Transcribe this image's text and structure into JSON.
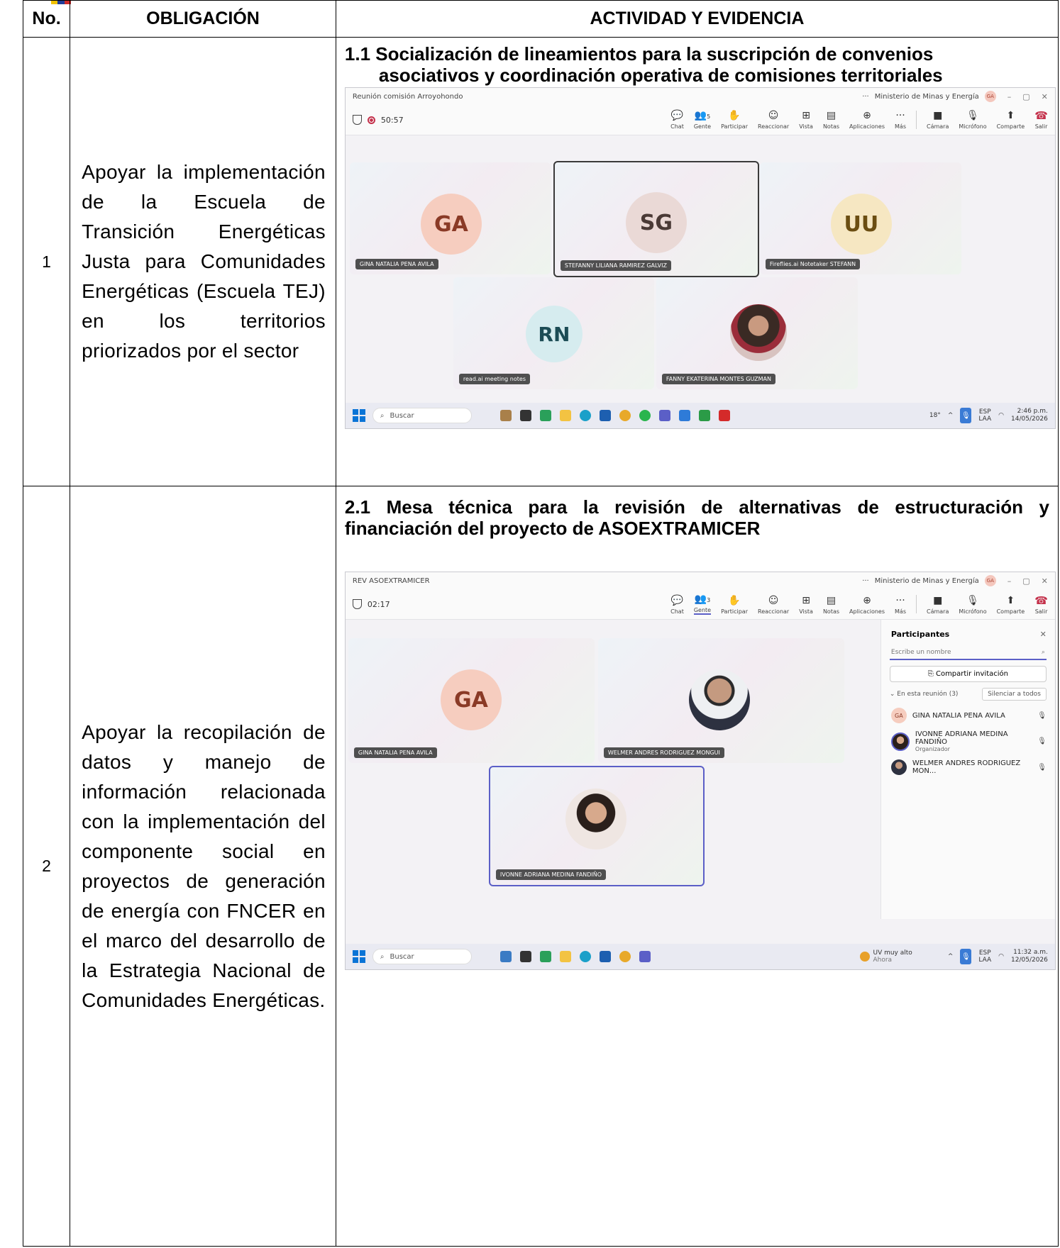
{
  "table": {
    "headers": {
      "no": "No.",
      "obligation": "OBLIGACIÓN",
      "activity": "ACTIVIDAD Y EVIDENCIA"
    },
    "rows": [
      {
        "no": "1",
        "obligation": "Apoyar la implementación de la Escuela de Transición Energéticas Justa para Comunidades Energéticas (Escuela TEJ) en los territorios priorizados por el sector",
        "activity_title_line1": "1.1 Socialización de lineamientos para la suscripción de convenios",
        "activity_title_line2": "asociativos y coordinación operativa de comisiones territoriales",
        "screenshot": {
          "window_title": "Reunión comisión Arroyohondo",
          "org": "Ministerio de Minas y Energía",
          "org_avatar": "GA",
          "timer": "50:57",
          "people_count": "5",
          "toolbar": [
            "Chat",
            "Gente",
            "Participar",
            "Reaccionar",
            "Vista",
            "Notas",
            "Aplicaciones",
            "Más",
            "Cámara",
            "Micrófono",
            "Comparte",
            "Salir"
          ],
          "participants": [
            {
              "initials": "GA",
              "name": "GINA NATALIA PENA AVILA",
              "color": "#f6cdbf",
              "text_color": "#8a3a26"
            },
            {
              "initials": "SG",
              "name": "STEFANNY LILIANA RAMIREZ GALVIZ",
              "color": "#ead9d6",
              "text_color": "#4a3a36"
            },
            {
              "initials": "UU",
              "name": "Fireflies.ai Notetaker STEFANN",
              "color": "#f6e7c2",
              "text_color": "#6b4e12"
            },
            {
              "initials": "RN",
              "name": "read.ai meeting notes",
              "color": "#d6ecef",
              "text_color": "#1c4c55"
            },
            {
              "initials": "",
              "name": "FANNY EKATERINA MONTES GUZMAN",
              "photo": true
            }
          ],
          "taskbar_search": "Buscar",
          "tray_weather": "18°",
          "tray_lang": "ESP",
          "tray_layout": "LAA",
          "time": "2:46 p.m.",
          "date": "14/05/2026"
        }
      },
      {
        "no": "2",
        "obligation": "Apoyar la recopilación de datos y manejo de información relacionada con la implementación del componente social en proyectos de generación de energía con FNCER en el marco del desarrollo de la Estrategia Nacional de Comunidades Energéticas.",
        "activity_title": "2.1 Mesa técnica para la revisión de alternativas de estructuración y financiación del proyecto de ASOEXTRAMICER",
        "screenshot": {
          "window_title": "REV ASOEXTRAMICER",
          "org": "Ministerio de Minas y Energía",
          "org_avatar": "GA",
          "timer": "02:17",
          "people_count": "3",
          "toolbar": [
            "Chat",
            "Gente",
            "Participar",
            "Reaccionar",
            "Vista",
            "Notas",
            "Aplicaciones",
            "Más",
            "Cámara",
            "Micrófono",
            "Comparte",
            "Salir"
          ],
          "tiles": [
            {
              "initials": "GA",
              "name": "GINA NATALIA PENA AVILA"
            },
            {
              "name": "WELMER ANDRES RODRIGUEZ MONGUI"
            },
            {
              "name": "IVONNE ADRIANA MEDINA FANDIÑO"
            }
          ],
          "panel": {
            "title": "Participantes",
            "search_placeholder": "Escribe un nombre",
            "invite": "Compartir invitación",
            "in_meeting": "En esta reunión (3)",
            "mute_all": "Silenciar a todos",
            "people": [
              {
                "initials": "GA",
                "name": "GINA NATALIA PENA AVILA",
                "role": ""
              },
              {
                "name": "IVONNE ADRIANA MEDINA FANDIÑO",
                "role": "Organizador"
              },
              {
                "name": "WELMER ANDRES RODRIGUEZ MON...",
                "role": ""
              }
            ]
          },
          "taskbar_search": "Buscar",
          "tray_weather_title": "UV muy alto",
          "tray_weather_sub": "Ahora",
          "tray_lang": "ESP",
          "tray_layout": "LAA",
          "time": "11:32 a.m.",
          "date": "12/05/2026"
        }
      }
    ]
  }
}
